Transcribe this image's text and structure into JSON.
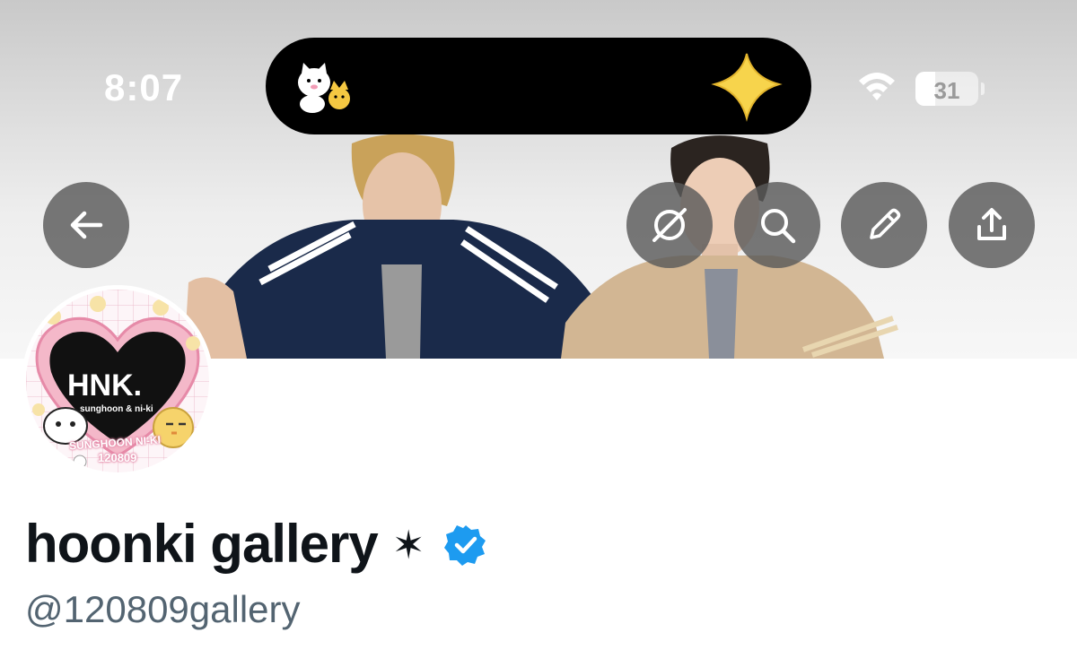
{
  "status_bar": {
    "time": "8:07",
    "battery_percent": 31,
    "battery_label": "31"
  },
  "header": {
    "back_button_icon": "arrow-left-icon",
    "actions": [
      {
        "icon": "unmute-icon"
      },
      {
        "icon": "search-icon"
      },
      {
        "icon": "pencil-icon"
      },
      {
        "icon": "share-icon"
      }
    ]
  },
  "avatar": {
    "title": "HNK.",
    "subtitle": "sunghoon & ni-ki",
    "names": "SUNGHOON NI-KI",
    "date": "120809"
  },
  "profile": {
    "display_name": "hoonki gallery",
    "name_symbol": "✶",
    "verified": true,
    "handle": "@120809gallery"
  },
  "colors": {
    "verified_blue": "#1d9bf0",
    "handle_gray": "#536471",
    "button_bg": "#5a5a5a"
  }
}
